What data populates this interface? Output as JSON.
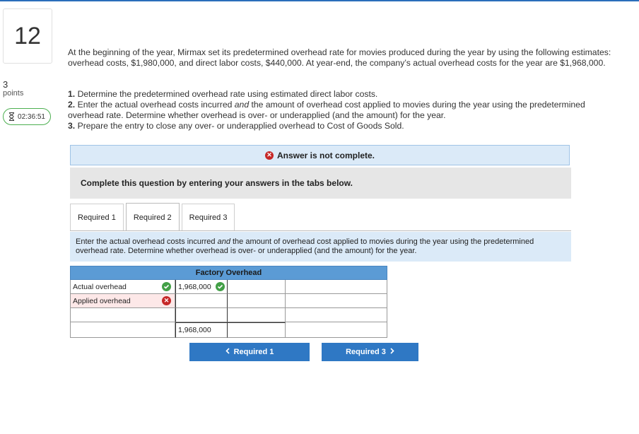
{
  "question": {
    "number": "12",
    "points_value": "3",
    "points_label": "points",
    "timer": "02:36:51"
  },
  "prompt": "At the beginning of the year, Mirmax set its predetermined overhead rate for movies produced during the year by using the following estimates: overhead costs, $1,980,000, and direct labor costs, $440,000. At year-end, the company’s actual overhead costs for the year are $1,968,000.",
  "tasks": {
    "t1_num": "1.",
    "t1": "Determine the predetermined overhead rate using estimated direct labor costs.",
    "t2_num": "2.",
    "t2_a": "Enter the actual overhead costs incurred",
    "t2_and": "and",
    "t2_b": "the amount of overhead cost applied to movies during the year using the predetermined overhead rate. Determine whether overhead is over- or underapplied (and the amount) for the year.",
    "t3_num": "3.",
    "t3": "Prepare the entry to close any over- or underapplied overhead to Cost of Goods Sold."
  },
  "notice": {
    "text": "Answer is not complete."
  },
  "complete_text": "Complete this question by entering your answers in the tabs below.",
  "tabs": [
    {
      "label": "Required 1"
    },
    {
      "label": "Required 2"
    },
    {
      "label": "Required 3"
    }
  ],
  "instruction": {
    "a": "Enter the actual overhead costs incurred",
    "and": "and",
    "b": "the amount of overhead cost applied to movies during the year using the predetermined overhead rate. Determine whether overhead is over- or underapplied (and the amount) for the year."
  },
  "t_account": {
    "title": "Factory Overhead",
    "rows": [
      {
        "label": "Actual overhead",
        "debit": "1,968,000",
        "credit": "",
        "credit_label": ""
      },
      {
        "label": "Applied overhead",
        "debit": "",
        "credit": "",
        "credit_label": ""
      },
      {
        "label": "",
        "debit": "",
        "credit": "",
        "credit_label": ""
      }
    ],
    "total_debit": "1,968,000",
    "total_credit": "",
    "total_label": ""
  },
  "nav": {
    "prev_label": "Required 1",
    "next_label": "Required 3"
  },
  "colors": {
    "accent": "#2f78c4",
    "header_blue": "#5b9bd5",
    "notice_bg": "#dbeaf8",
    "correct": "#43a047",
    "incorrect": "#c62828"
  }
}
